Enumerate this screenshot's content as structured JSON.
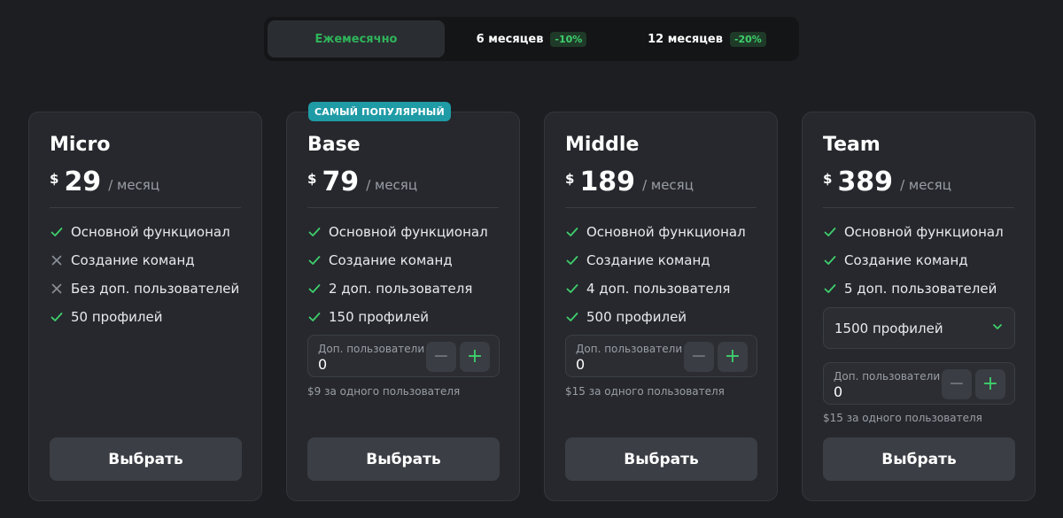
{
  "billing": {
    "options": [
      {
        "label": "Ежемесячно",
        "discount": ""
      },
      {
        "label": "6 месяцев",
        "discount": "-10%"
      },
      {
        "label": "12 месяцев",
        "discount": "-20%"
      }
    ],
    "selected": "Ежемесячно"
  },
  "currency": "$",
  "per_label": "/ месяц",
  "select_label": "Выбрать",
  "stepper_label": "Доп. пользователи",
  "popular_badge": "САМЫЙ ПОПУЛЯРНЫЙ",
  "colors": {
    "accent": "#3fcf6c",
    "badge": "#1f9ba6",
    "card": "#26282d",
    "background": "#1c1e22"
  },
  "plans": [
    {
      "name": "Micro",
      "price": "29",
      "features": [
        {
          "text": "Основной функционал",
          "icon": "check-icon"
        },
        {
          "text": "Создание команд",
          "icon": "cross-icon"
        },
        {
          "text": "Без доп. пользователей",
          "icon": "cross-icon"
        },
        {
          "text": "50 профилей",
          "icon": "check-icon"
        }
      ]
    },
    {
      "name": "Base",
      "price": "79",
      "features": [
        {
          "text": "Основной функционал",
          "icon": "check-icon"
        },
        {
          "text": "Создание команд",
          "icon": "check-icon"
        },
        {
          "text": "2 доп. пользователя",
          "icon": "check-icon"
        },
        {
          "text": "150 профилей",
          "icon": "check-icon"
        }
      ],
      "stepper_value": "0",
      "note": "$9 за одного пользователя"
    },
    {
      "name": "Middle",
      "price": "189",
      "features": [
        {
          "text": "Основной функционал",
          "icon": "check-icon"
        },
        {
          "text": "Создание команд",
          "icon": "check-icon"
        },
        {
          "text": "4 доп. пользователя",
          "icon": "check-icon"
        },
        {
          "text": "500 профилей",
          "icon": "check-icon"
        }
      ],
      "stepper_value": "0",
      "note": "$15 за одного пользователя"
    },
    {
      "name": "Team",
      "price": "389",
      "features": [
        {
          "text": "Основной функционал",
          "icon": "check-icon"
        },
        {
          "text": "Создание команд",
          "icon": "check-icon"
        },
        {
          "text": "5 доп. пользователей",
          "icon": "check-icon"
        }
      ],
      "profiles_selected": "1500 профилей",
      "stepper_value": "0",
      "note": "$15 за одного пользователя"
    }
  ]
}
